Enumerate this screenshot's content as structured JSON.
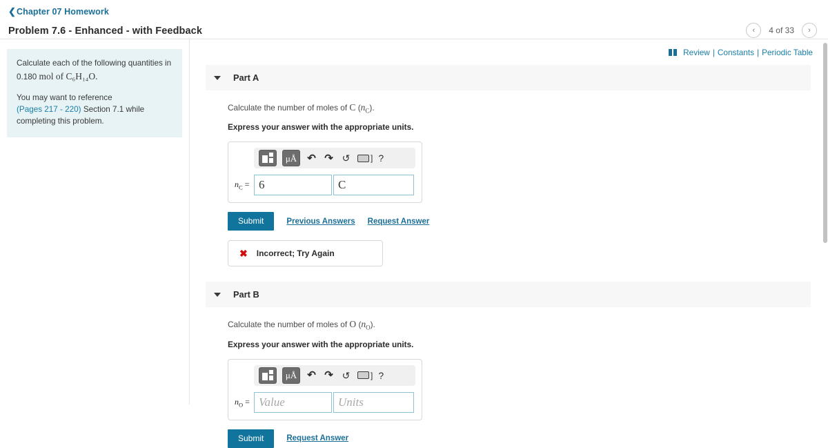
{
  "header": {
    "breadcrumb_label": "Chapter 07 Homework",
    "breadcrumb_chevron": "chevron-left-icon",
    "problem_title": "Problem 7.6 - Enhanced - with Feedback",
    "pager": {
      "prev_glyph": "‹",
      "next_glyph": "›",
      "counter": "4 of 33"
    }
  },
  "sidebar": {
    "intro_line1": "Calculate each of the following quantities in 0.180",
    "intro_formula": "mol of C₆H₁₄O.",
    "reference_line": "You may want to reference",
    "reference_link": "(Pages 217 - 220)",
    "reference_rest": "Section 7.1 while completing this problem."
  },
  "utilities": {
    "book_icon": "book-icon",
    "review": "Review",
    "separator": "|",
    "constants": "Constants",
    "periodic_table": "Periodic Table"
  },
  "toolbar": {
    "template_button": "math-template-button",
    "units_button_label": "μÅ",
    "undo_glyph": "↶",
    "redo_glyph": "↷",
    "reset_glyph": "↺",
    "keyboard_bracket": "]",
    "help_glyph": "?"
  },
  "parts": [
    {
      "id": "part-a",
      "label": "Part A",
      "prompt_prefix": "Calculate the number of moles of",
      "prompt_symbol": "C",
      "prompt_variable_open": "(",
      "prompt_variable": "n",
      "prompt_variable_sub": "C",
      "prompt_variable_close": ").",
      "instruction": "Express your answer with the appropriate units.",
      "answer_label_base": "n",
      "answer_label_sub": "C",
      "answer_label_eq": "=",
      "value": "6",
      "units": "C",
      "value_is_placeholder": false,
      "submit_label": "Submit",
      "links": [
        "Previous Answers",
        "Request Answer"
      ],
      "feedback": {
        "icon": "error-x-icon",
        "text": "Incorrect; Try Again"
      }
    },
    {
      "id": "part-b",
      "label": "Part B",
      "prompt_prefix": "Calculate the number of moles of",
      "prompt_symbol": "O",
      "prompt_variable_open": "(",
      "prompt_variable": "n",
      "prompt_variable_sub": "O",
      "prompt_variable_close": ").",
      "instruction": "Express your answer with the appropriate units.",
      "answer_label_base": "n",
      "answer_label_sub": "O",
      "answer_label_eq": "=",
      "value": "Value",
      "units": "Units",
      "value_is_placeholder": true,
      "submit_label": "Submit",
      "links": [
        "Request Answer"
      ],
      "feedback": null
    }
  ],
  "colors": {
    "accent_teal": "#11749c",
    "link_blue": "#1a6f97",
    "sidebar_bg": "#e7f3f4",
    "part_header_bg": "#f7f7f7",
    "error_red": "#d20d0d",
    "field_border": "#8fc0d4"
  }
}
